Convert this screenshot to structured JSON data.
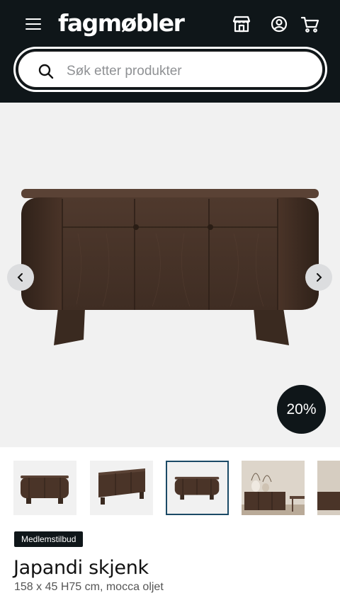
{
  "header": {
    "logo": "fagmøbler",
    "icons": [
      "menu-icon",
      "store-icon",
      "account-icon",
      "cart-icon"
    ]
  },
  "search": {
    "placeholder": "Søk etter produkter"
  },
  "gallery": {
    "discount_badge": "20%",
    "selected_thumbnail": 3
  },
  "product": {
    "badge": "Medlemstilbud",
    "title": "Japandi skjenk",
    "subtitle": "158 x 45 H75 cm, mocca oljet"
  },
  "colors": {
    "header_bg": "#0f1619",
    "wood": "#4a3428",
    "selected_border": "#1b4a66"
  }
}
